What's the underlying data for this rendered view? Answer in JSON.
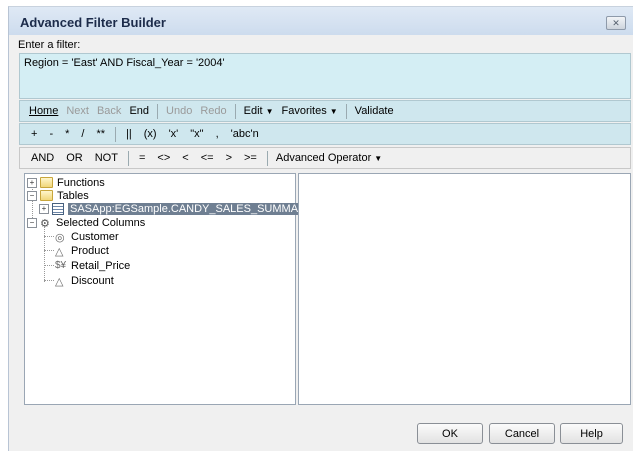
{
  "window": {
    "title": "Advanced Filter Builder",
    "close_glyph": "✕"
  },
  "prompt": "Enter a filter:",
  "expression": "Region = 'East' AND Fiscal_Year = '2004'",
  "toolbar1": {
    "home": "Home",
    "next": "Next",
    "back": "Back",
    "end": "End",
    "undo": "Undo",
    "redo": "Redo",
    "edit": "Edit",
    "favorites": "Favorites",
    "validate": "Validate"
  },
  "toolbar2": [
    "+",
    "-",
    "*",
    "/",
    "**",
    "||",
    "(x)",
    "'x'",
    "\"x\"",
    ",",
    "'abc'n"
  ],
  "toolbar3": {
    "ops": [
      "AND",
      "OR",
      "NOT",
      "=",
      "<>",
      "<",
      "<=",
      ">",
      ">="
    ],
    "advanced": "Advanced Operator"
  },
  "tree": {
    "functions": "Functions",
    "tables": "Tables",
    "table_name": "SASApp:EGSample.CANDY_SALES_SUMMARY",
    "selected_columns": "Selected Columns",
    "columns": [
      "Customer",
      "Product",
      "Retail_Price",
      "Discount"
    ]
  },
  "buttons": {
    "ok": "OK",
    "cancel": "Cancel",
    "help": "Help"
  },
  "icons": {
    "folder": "folder-icon",
    "table": "table-icon",
    "columns": "columns-icon",
    "char_col": "character-column-icon",
    "num_col": "currency-column-icon"
  }
}
